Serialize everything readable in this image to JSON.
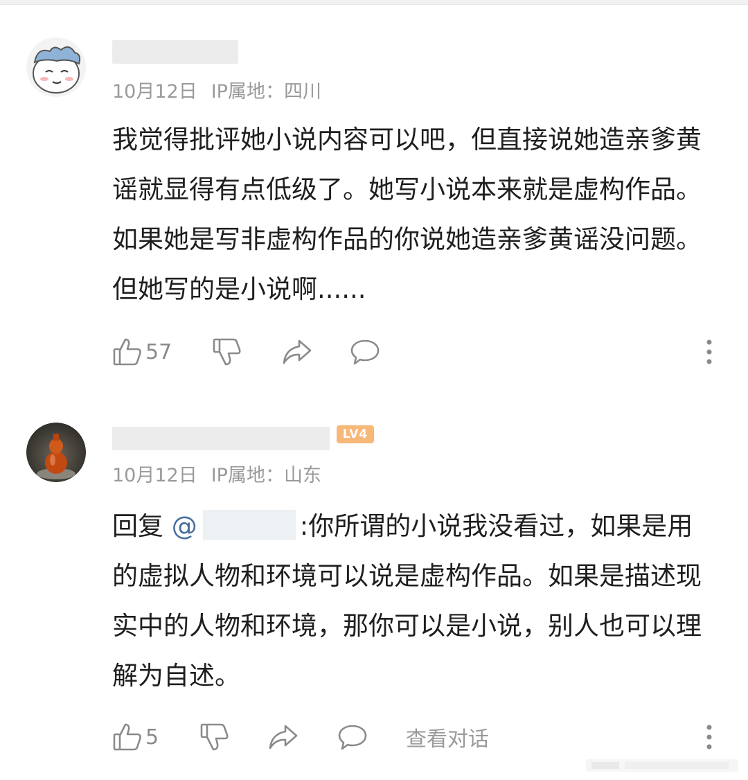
{
  "comments": [
    {
      "date": "10月12日",
      "ip_label": "IP属地：",
      "ip_location": "四川",
      "text": "我觉得批评她小说内容可以吧，但直接说她造亲爹黄谣就显得有点低级了。她写小说本来就是虚构作品。如果她是写非虚构作品的你说她造亲爹黄谣没问题。但她写的是小说啊......",
      "likes": "57"
    },
    {
      "level": "LV4",
      "date": "10月12日",
      "ip_label": "IP属地：",
      "ip_location": "山东",
      "reply_prefix": "回复 ",
      "mention_symbol": "@",
      "reply_text": ":你所谓的小说我没看过，如果是用的虚拟人物和环境可以说是虚构作品。如果是描述现实中的人物和环境，那你可以是小说，别人也可以理解为自述。",
      "likes": "5",
      "view_dialog": "查看对话"
    }
  ],
  "icons": {
    "like": "thumbs-up-icon",
    "dislike": "thumbs-down-icon",
    "share": "share-arrow-icon",
    "reply": "speech-bubble-icon",
    "more": "more-vertical-icon"
  },
  "colors": {
    "meta_text": "#9a9a9a",
    "body_text": "#1f1f1f",
    "mention": "#4a6e9c",
    "level_badge": "#f7b87a",
    "icon": "#8a8a8a"
  }
}
